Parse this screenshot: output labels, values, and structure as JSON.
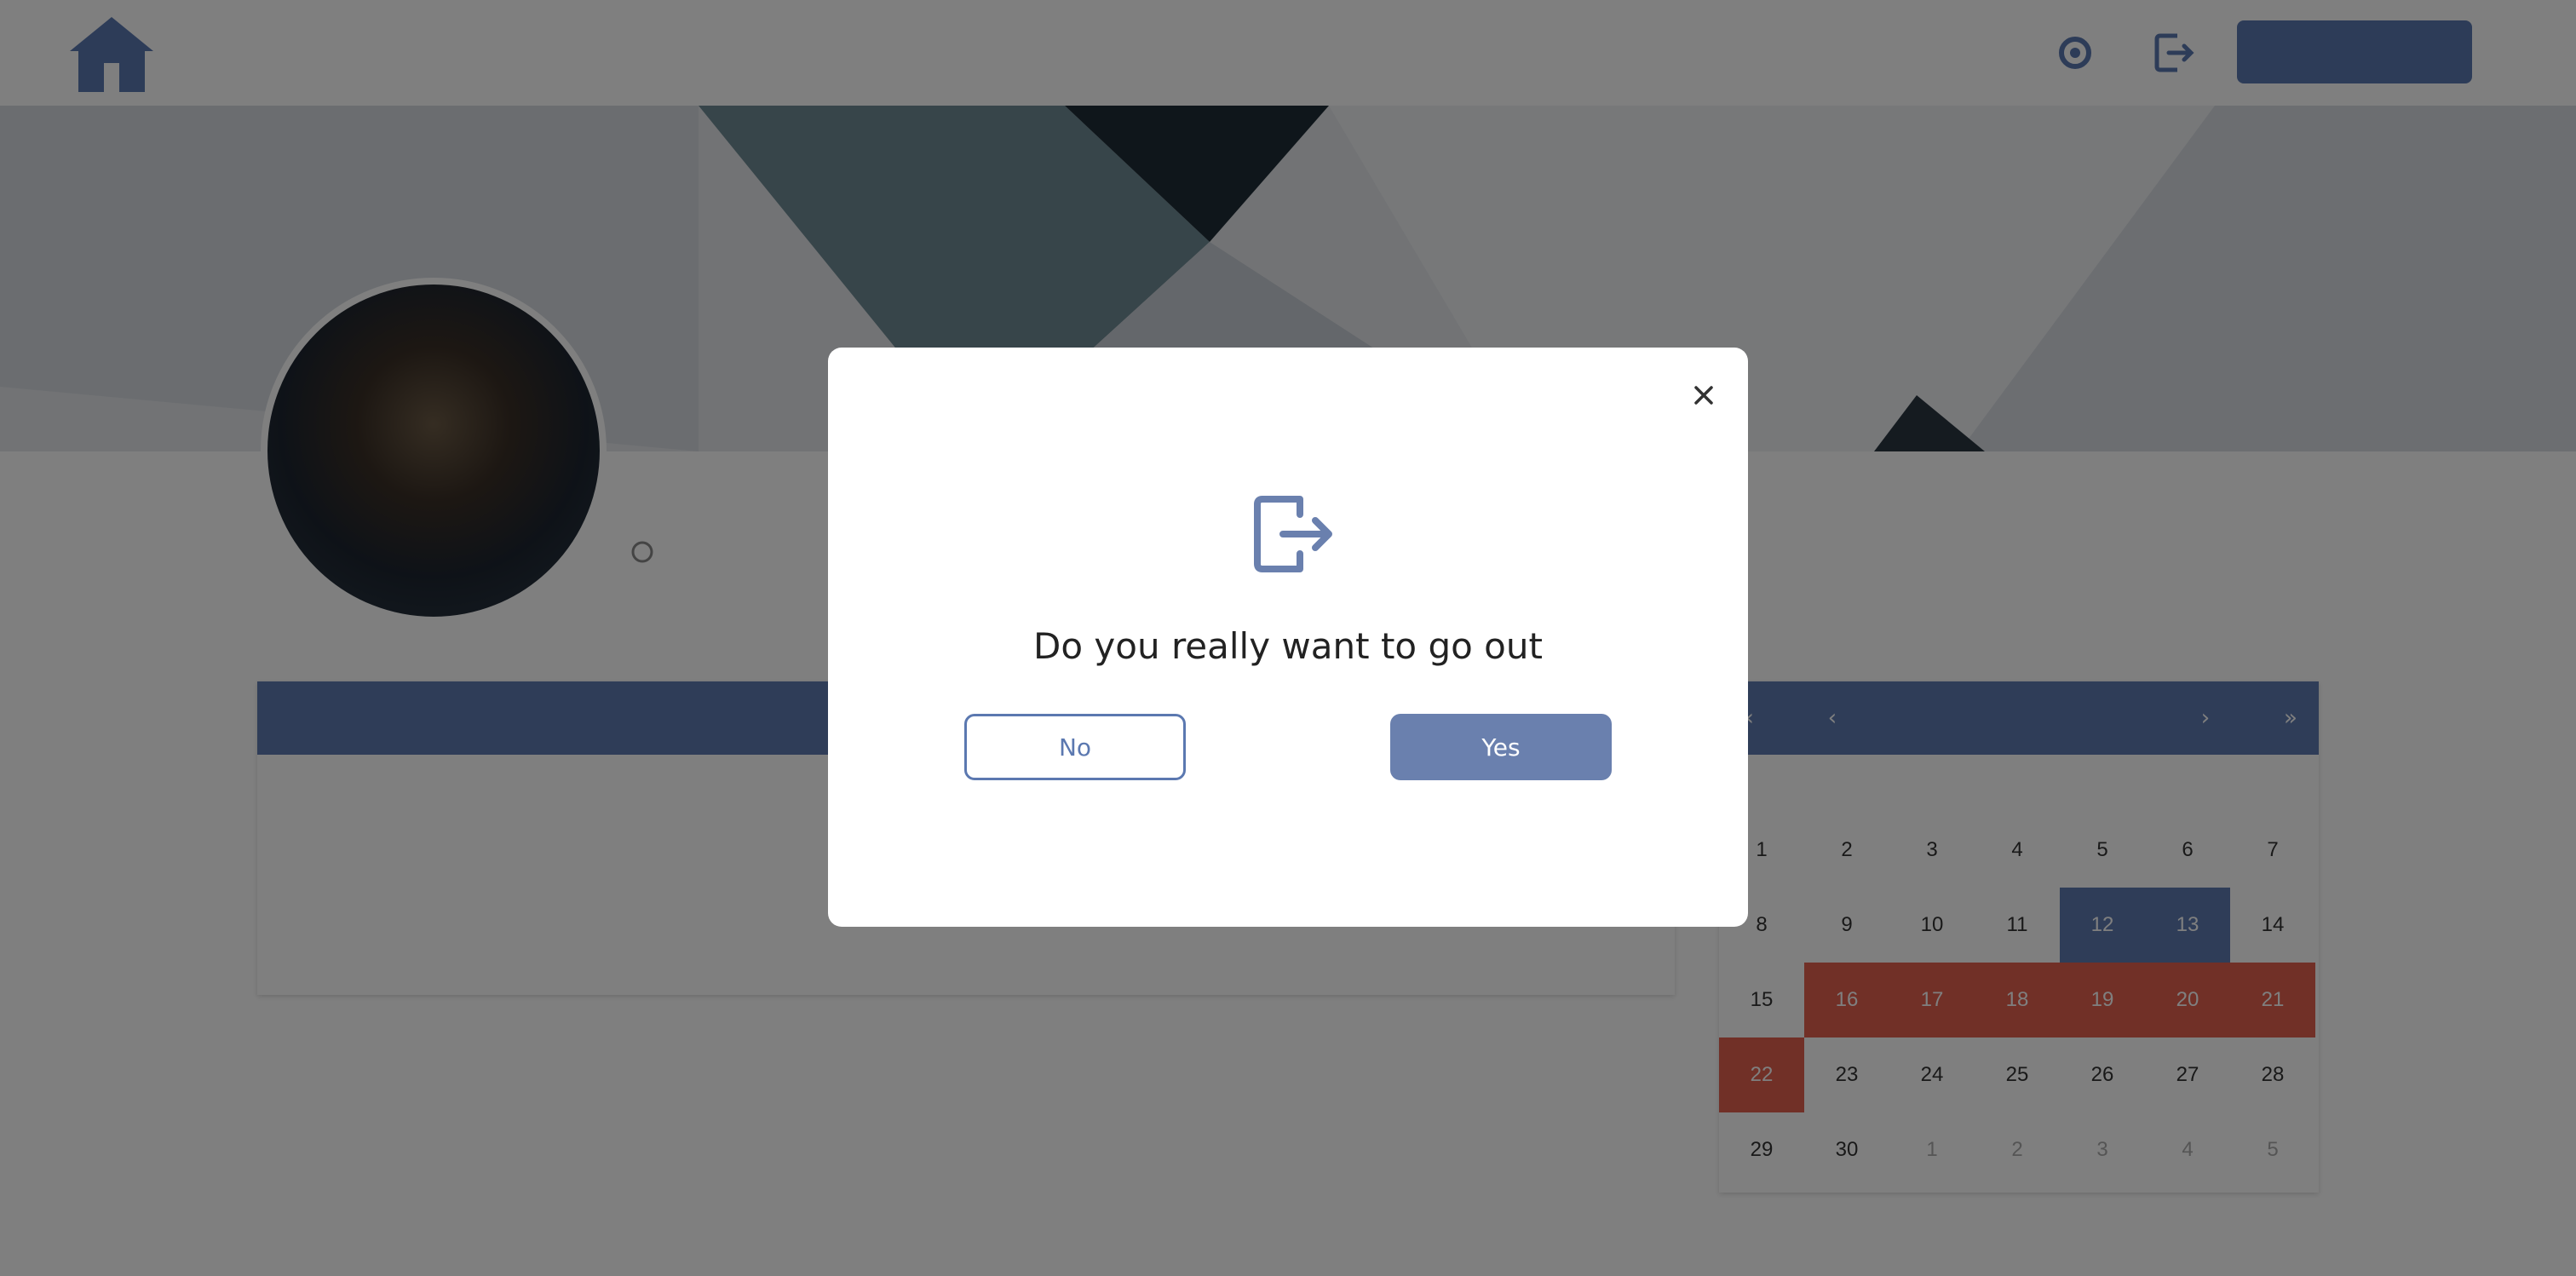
{
  "header": {
    "logo_icon": "home-icon",
    "settings_icon": "gear-icon",
    "logout_icon": "logout-icon",
    "create_button_label": ""
  },
  "profile": {
    "name": "",
    "subtitle": ""
  },
  "requests_panel": {
    "title": "",
    "request": {
      "title": "",
      "start_label": "",
      "start_value": "",
      "status_label": "",
      "status_value": "",
      "edit_label": "",
      "delete_label": ""
    }
  },
  "calendar": {
    "title": "",
    "weekdays": [
      "",
      "",
      "",
      "",
      "",
      "",
      ""
    ],
    "weeks": [
      [
        {
          "d": "1"
        },
        {
          "d": "2"
        },
        {
          "d": "3"
        },
        {
          "d": "4"
        },
        {
          "d": "5"
        },
        {
          "d": "6"
        },
        {
          "d": "7"
        }
      ],
      [
        {
          "d": "8"
        },
        {
          "d": "9"
        },
        {
          "d": "10"
        },
        {
          "d": "11"
        },
        {
          "d": "12",
          "s": "blue"
        },
        {
          "d": "13",
          "s": "blue"
        },
        {
          "d": "14"
        }
      ],
      [
        {
          "d": "15"
        },
        {
          "d": "16",
          "s": "red"
        },
        {
          "d": "17",
          "s": "red"
        },
        {
          "d": "18",
          "s": "red"
        },
        {
          "d": "19",
          "s": "red"
        },
        {
          "d": "20",
          "s": "red"
        },
        {
          "d": "21",
          "s": "red"
        }
      ],
      [
        {
          "d": "22",
          "s": "red"
        },
        {
          "d": "23"
        },
        {
          "d": "24"
        },
        {
          "d": "25"
        },
        {
          "d": "26"
        },
        {
          "d": "27"
        },
        {
          "d": "28"
        }
      ],
      [
        {
          "d": "29"
        },
        {
          "d": "30"
        },
        {
          "d": "1",
          "s": "muted"
        },
        {
          "d": "2",
          "s": "muted"
        },
        {
          "d": "3",
          "s": "muted"
        },
        {
          "d": "4",
          "s": "muted"
        },
        {
          "d": "5",
          "s": "muted"
        }
      ]
    ]
  },
  "modal": {
    "icon": "logout-icon",
    "title": "Do you really want to go out",
    "no_label": "No",
    "yes_label": "Yes",
    "close_icon": "close-icon"
  },
  "colors": {
    "accent": "#5b78b0",
    "accent_muted": "#6a80ae",
    "danger": "#e3604f",
    "success": "#3aa14c",
    "overlay": "rgba(0,0,0,0.5)"
  }
}
